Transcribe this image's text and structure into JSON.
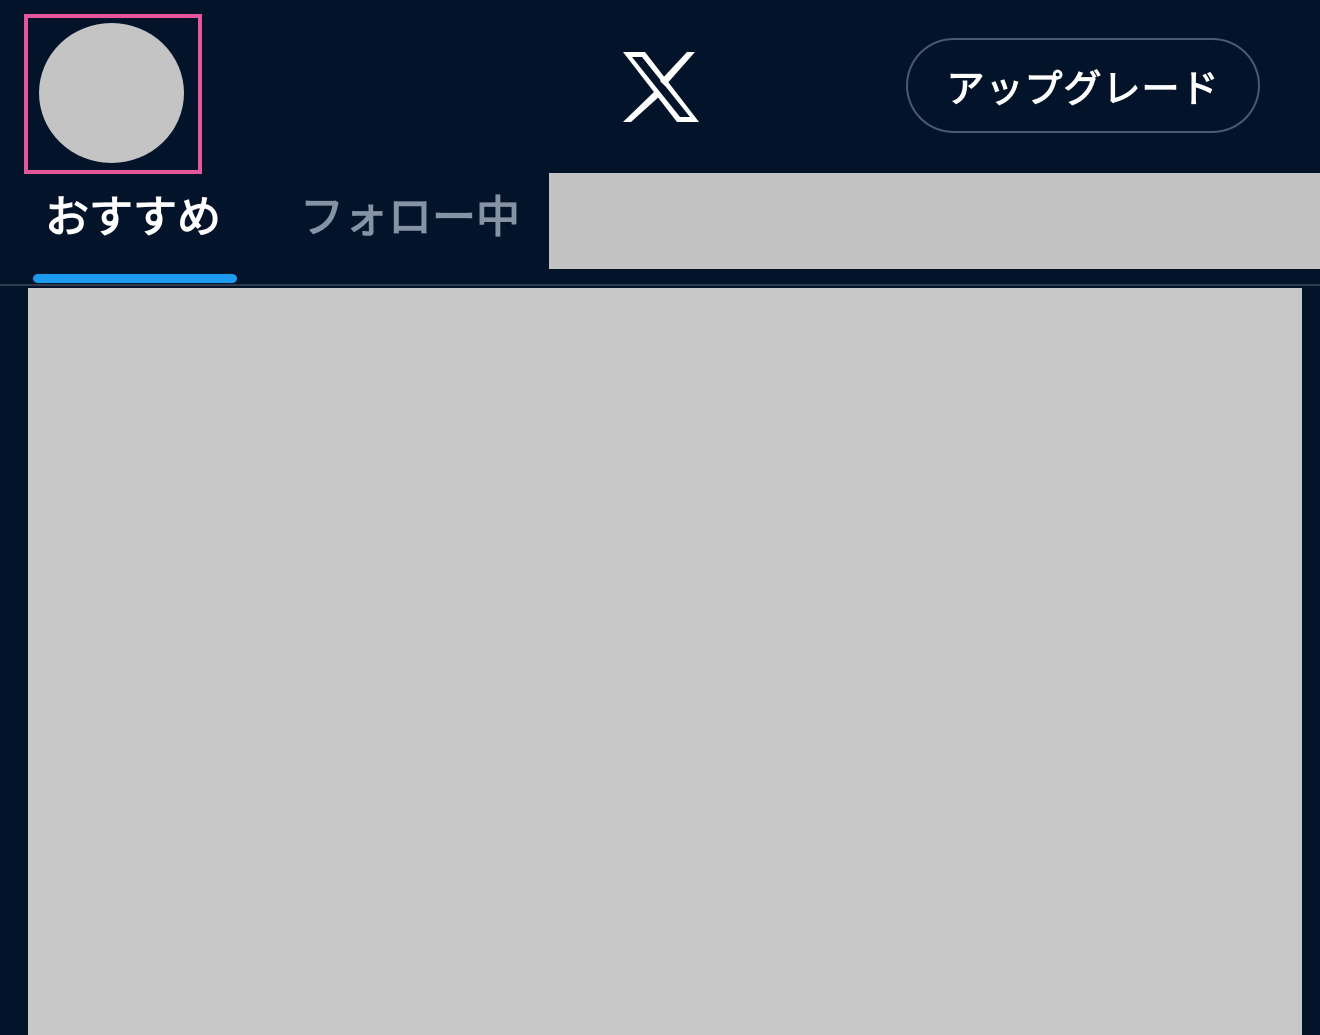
{
  "header": {
    "logo_icon": "x-logo-icon",
    "upgrade_label": "アップグレード"
  },
  "tabs": [
    {
      "label": "おすすめ",
      "active": true
    },
    {
      "label": "フォロー中",
      "active": false
    }
  ],
  "colors": {
    "background": "#02132A",
    "accent": "#1D9BF0",
    "highlight": "#E6569B",
    "placeholder": "#C4C4C4"
  }
}
